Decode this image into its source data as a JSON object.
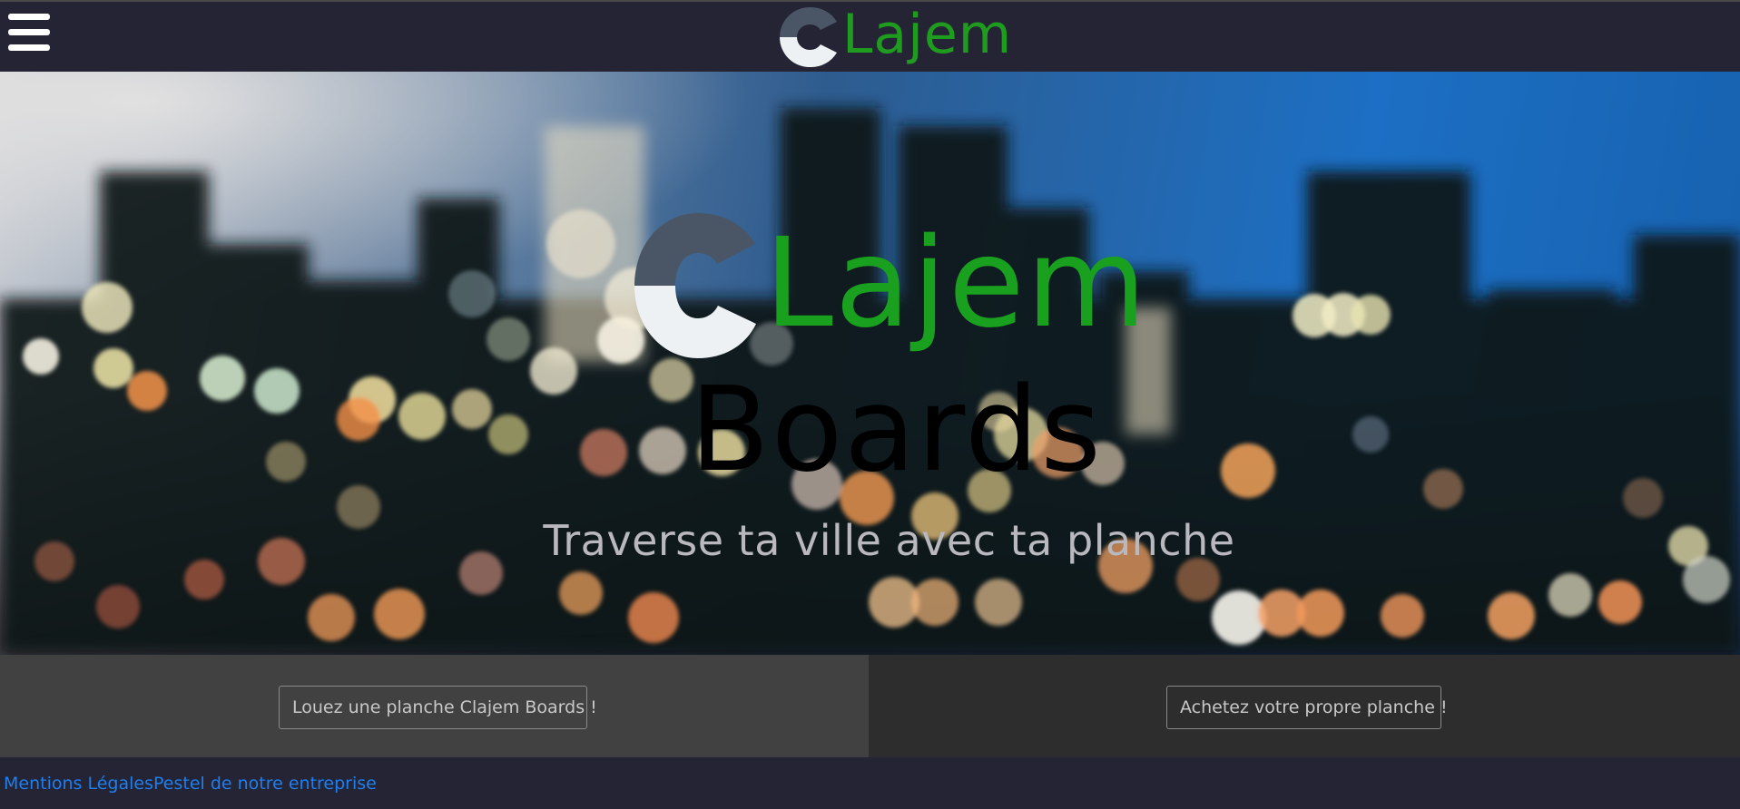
{
  "navbar": {
    "menu_icon": "hamburger-menu-icon",
    "logo_text": "Lajem",
    "logo_icon": "c-logo-icon"
  },
  "hero": {
    "brand_line1": "Lajem",
    "brand_line2": "Boards",
    "brand_c_icon": "c-logo-icon",
    "tagline": "Traverse ta ville avec ta planche",
    "background": "blurred-city-night-bokeh"
  },
  "actions": {
    "rent_label": "Louez une planche Clajem Boards !",
    "buy_label": "Achetez votre propre planche !"
  },
  "footer": {
    "links": [
      {
        "label": "Mentions Légales"
      },
      {
        "label": "Pestel de notre entreprise"
      }
    ]
  },
  "colors": {
    "navbar_bg": "#242434",
    "brand_green": "#1aa01f",
    "brand_dark_green": "#0f8a3a",
    "logo_c_dark": "#4a5566",
    "logo_c_light": "#eef1f4",
    "tagline": "#b8b8be",
    "action_left_bg": "#414141",
    "action_right_bg": "#2d2d2d",
    "link": "#1e7ff0"
  }
}
